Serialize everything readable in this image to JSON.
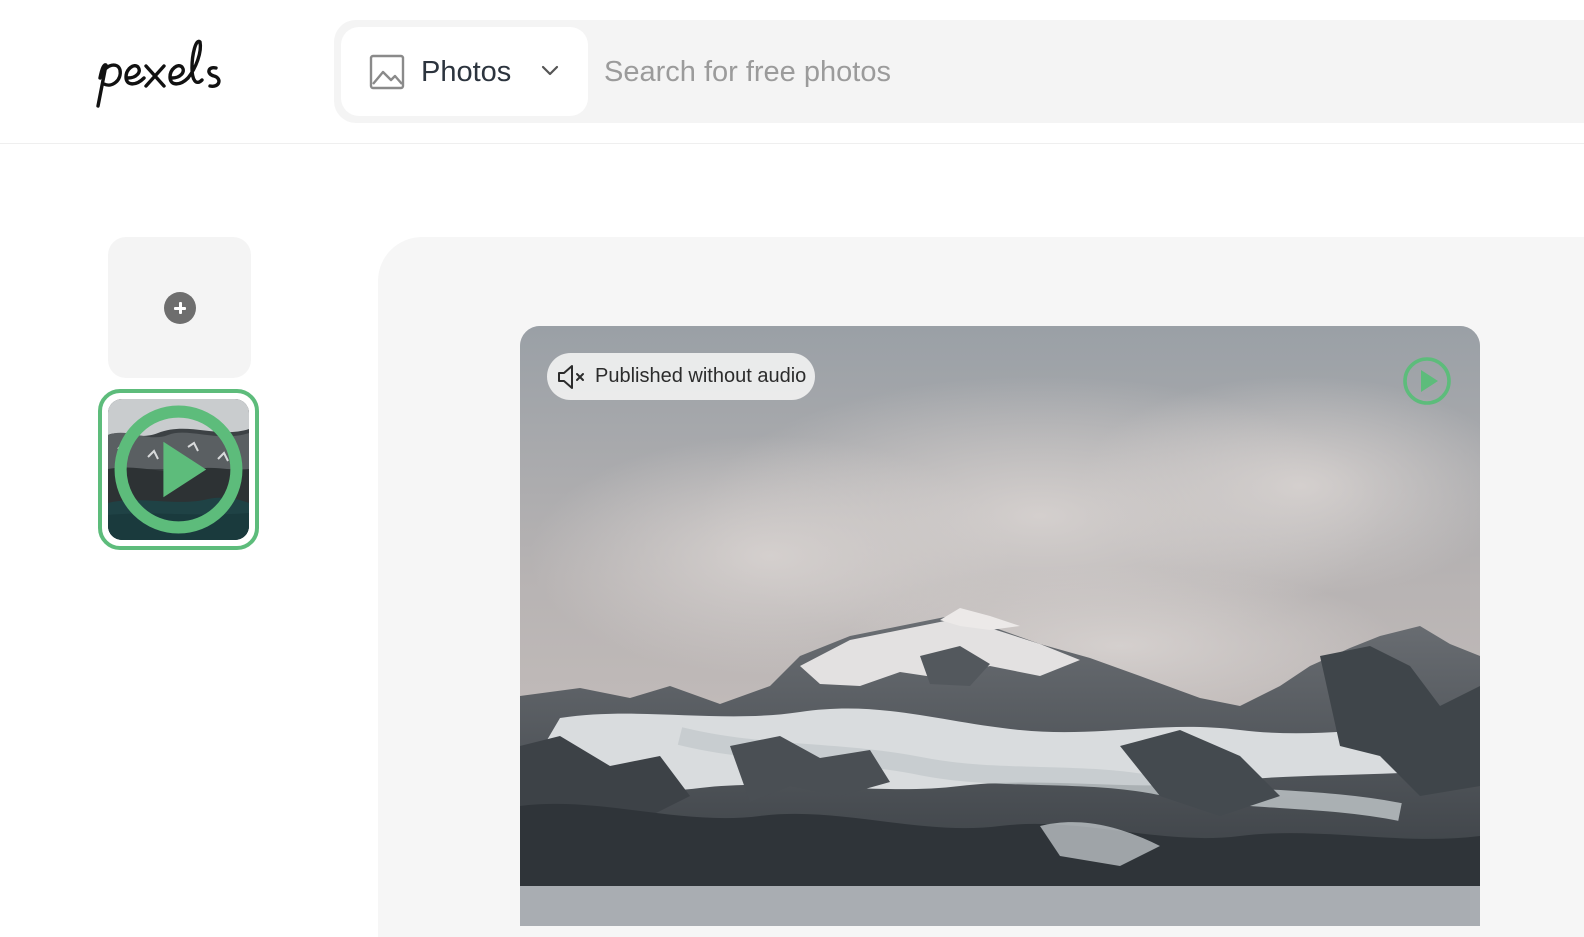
{
  "header": {
    "logo_text": "pexels",
    "search_type_label": "Photos",
    "search_placeholder": "Search for free photos"
  },
  "upload": {
    "add_icon": "plus-icon"
  },
  "thumbnails": [
    {
      "kind": "video",
      "selected": true,
      "overlay_icon": "play-circle-icon"
    }
  ],
  "preview": {
    "audio_badge": "Published without audio",
    "audio_icon": "speaker-muted-icon",
    "play_icon": "play-circle-icon"
  },
  "colors": {
    "accent": "#5dbc7b",
    "search_bg": "#f4f4f4",
    "panel_bg": "#f6f6f6"
  }
}
